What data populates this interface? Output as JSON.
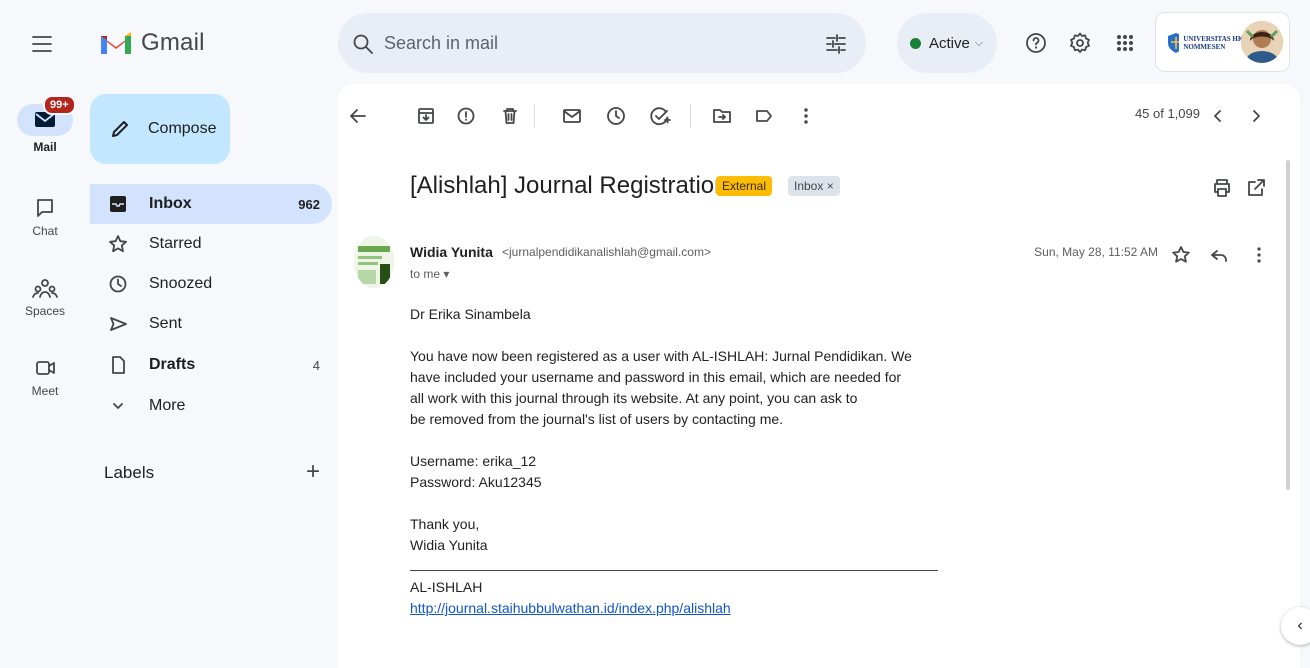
{
  "topbar": {
    "product": "Gmail",
    "search_placeholder": "Search in mail",
    "status_label": "Active",
    "org_logo_text": "UNIVERSITAS HKBP NOMMESEN"
  },
  "rail": {
    "mail_label": "Mail",
    "mail_badge": "99+",
    "chat_label": "Chat",
    "spaces_label": "Spaces",
    "meet_label": "Meet"
  },
  "nav": {
    "compose": "Compose",
    "items": [
      {
        "label": "Inbox",
        "count": "962",
        "icon": "inbox-icon"
      },
      {
        "label": "Starred",
        "count": "",
        "icon": "star-icon"
      },
      {
        "label": "Snoozed",
        "count": "",
        "icon": "clock-icon"
      },
      {
        "label": "Sent",
        "count": "",
        "icon": "send-icon"
      },
      {
        "label": "Drafts",
        "count": "4",
        "icon": "draft-icon"
      },
      {
        "label": "More",
        "count": "",
        "icon": "chevron-down-icon"
      }
    ],
    "labels_heading": "Labels"
  },
  "toolbar": {
    "pagination": "45 of 1,099"
  },
  "email": {
    "subject": "[Alishlah] Journal Registration",
    "tag_external": "External",
    "tag_inbox": "Inbox ×",
    "sender_name": "Widia Yunita",
    "sender_email": "<jurnalpendidikanalishlah@gmail.com>",
    "to": "to me ▾",
    "date": "Sun, May 28, 11:52 AM",
    "greeting": "Dr Erika Sinambela",
    "body_lines": [
      "You have now been registered as a user with AL-ISHLAH: Jurnal Pendidikan. We",
      "have included your username and password in this email, which are needed for",
      "all work with this journal through its website. At any point, you can ask to",
      "be removed from the journal's list of users by contacting me."
    ],
    "username": "Username: erika_12",
    "password": "Password: Aku12345",
    "closing": "Thank you,",
    "closing_name": "Widia Yunita",
    "signature_name": "AL-ISHLAH",
    "signature_link": "http://journal.staihubbulwathan.id/index.php/alishlah"
  },
  "colors": {
    "accent_blue": "#d3e3fd",
    "compose_bg": "#c2e7ff",
    "external_tag": "#fbbc04",
    "active_dot": "#188038",
    "badge": "#b3261e"
  }
}
